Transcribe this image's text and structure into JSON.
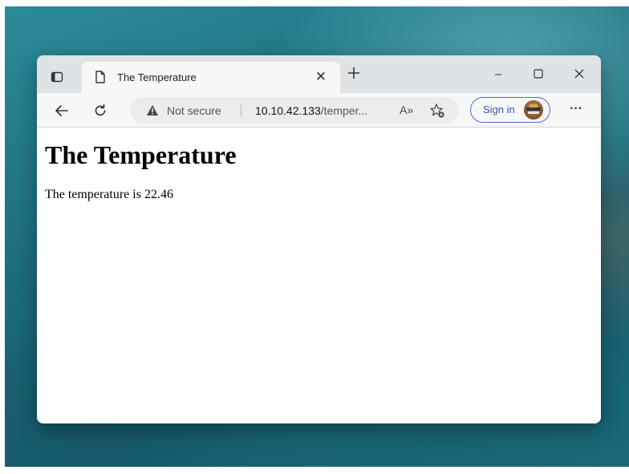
{
  "browser": {
    "tab": {
      "title": "The Temperature"
    },
    "address_bar": {
      "security_label": "Not secure",
      "url_host": "10.10.42.133",
      "url_path": "/temper..."
    },
    "toolbar": {
      "read_aloud_label": "A»",
      "signin_label": "Sign in",
      "more_label": "···"
    },
    "window_controls": {
      "minimize": "–",
      "maximize": "☐",
      "close": "✕"
    },
    "icons": [
      "tab-actions-icon",
      "page-icon",
      "close-icon",
      "plus-icon",
      "back-arrow-icon",
      "refresh-icon",
      "warning-icon",
      "favorites-icon",
      "avatar"
    ]
  },
  "page": {
    "heading": "The Temperature",
    "text": "The temperature is 22.46"
  },
  "colors": {
    "signin_accent": "#3b55b5",
    "titlebar": "#dfe3e6",
    "toolbar": "#f7f7f7"
  }
}
